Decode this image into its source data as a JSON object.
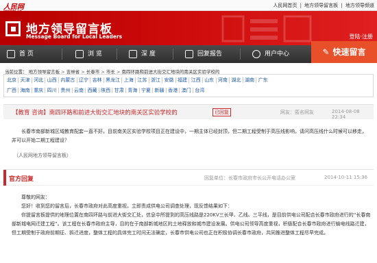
{
  "topbar": {
    "logo": "人民网",
    "logo_sub": "people.cn",
    "links": [
      "人民网首页",
      "|",
      "地方领导留言板",
      "|",
      "地方领导频道"
    ]
  },
  "banner": {
    "title": "地方领导留言板",
    "subtitle": "Message Board for Local Leaders",
    "login": "登陆·注册"
  },
  "nav": {
    "items": [
      "首 页",
      "浏 览",
      "深 度",
      "回复报告",
      "用户中心"
    ],
    "quick": "快速留言"
  },
  "breadcrumb": {
    "prefix": "当前位置：",
    "items": [
      "地方领导留言板",
      "吉林省",
      "长春市",
      "市长",
      "南四环路和前进大街交汇地块的南关区实验学校的"
    ]
  },
  "provinces": {
    "row1": [
      "北京",
      "天津",
      "河北",
      "山西",
      "内蒙古",
      "辽宁",
      "吉林",
      "黑龙江",
      "上海",
      "江苏",
      "浙江",
      "安徽",
      "福建",
      "江西",
      "山东",
      "河南",
      "湖北",
      "湖南",
      "广东"
    ],
    "row2": [
      "广西",
      "海南",
      "重庆",
      "四川",
      "贵州",
      "云南",
      "西藏",
      "陕西",
      "甘肃",
      "青海",
      "宁夏",
      "新疆",
      "香港",
      "澳门",
      "台湾"
    ]
  },
  "message": {
    "title": "【教育 咨询】南四环路和前进大街交汇地块的南关区实验学校的",
    "status": "已回复",
    "user": "网友：匿名网友",
    "time": "2014-08-08 22:34",
    "body": "长春市南部新城区域教育配套一直不好。目前南关区实验学校项目正在建设中，一期主体已经封顶，但二期工程受制于高压线影响，请问高压线什么时候可以移走，并可以开始二期工程建设？",
    "source": "（人民网地方领导留言板）"
  },
  "reply": {
    "label": "官方回复",
    "user": "回复单位：长春市政府市长公开电话办公室",
    "time": "2014-10-11 15:36",
    "greeting": "尊敬的网友：",
    "line1": "您好！收到您的留言后，长春市政府对此高度重视，立即责成供电公司调查处理，现反馈结果如下：",
    "body": "你提留言板提供的地理位置在南四环路与前进大街交汇处，信息中所提到的高压线路是220KV三长甲、乙线、三平线，是目前供电公司配合长春市政府进行的“长春南部新城电网迁建工程”。该工程在长春市政府主导，目的在于南部新城地区的土地释放和城市建设发展。供电公司领导高度重视，积极配合长春市政府进行输电线路迁建，但工期受制于政府前期征、拆迁进度，整体工程的具体完工时间无法确定，长春市供电公司也正在积极协调长春市政府，共同推进整体工程尽早完成。"
  },
  "colors": {
    "brand_red": "#c8282b",
    "banner_red": "#cc0a0a",
    "quick_orange": "#e8502a",
    "link_blue": "#1f5aa8"
  }
}
